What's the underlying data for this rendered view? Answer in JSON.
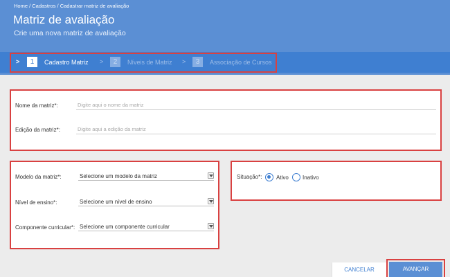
{
  "breadcrumb": "Home / Cadastros / Cadastrar matriz de avaliação",
  "page": {
    "title": "Matriz de avaliação",
    "subtitle": "Crie uma nova matriz de avaliação"
  },
  "steps": [
    {
      "number": "1",
      "label": "Cadastro Matriz",
      "state": "active"
    },
    {
      "number": "2",
      "label": "Níveis de Matriz",
      "state": "inactive"
    },
    {
      "number": "3",
      "label": "Associação de Cursos",
      "state": "inactive"
    }
  ],
  "form": {
    "nome": {
      "label": "Nome da matriz*:",
      "value": "",
      "placeholder": "Digite aqui o nome da matriz"
    },
    "edicao": {
      "label": "Edição da matriz*:",
      "value": "",
      "placeholder": "Digite aqui a edição da matriz"
    },
    "modelo": {
      "label": "Modelo da matriz*:",
      "selected": "Selecione um modelo da matriz"
    },
    "nivel": {
      "label": "Nível de ensino*:",
      "selected": "Selecione um nível de ensino"
    },
    "componente": {
      "label": "Componente curricular*:",
      "selected": "Selecione um componente curricular"
    },
    "situacao": {
      "label": "Situação*:",
      "options": [
        {
          "label": "Ativo",
          "checked": true
        },
        {
          "label": "Inativo",
          "checked": false
        }
      ]
    }
  },
  "buttons": {
    "cancel": "CANCELAR",
    "next": "AVANÇAR"
  },
  "colors": {
    "header": "#5b8fd4",
    "stepbar": "#3f7fd1",
    "highlight": "#d94141",
    "background": "#ececec"
  }
}
